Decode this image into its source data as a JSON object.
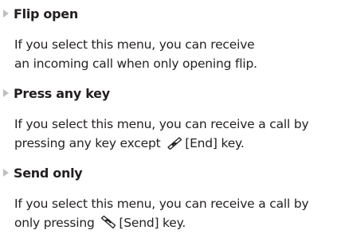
{
  "sections": [
    {
      "heading": "Flip open",
      "text": "If you select this menu, you can receive an incoming call when only opening flip."
    },
    {
      "heading": "Press any key",
      "text_before_icon": "If you select this menu, you can receive a call by pressing any key except",
      "icon": "end-key-icon",
      "text_after_icon": "[End] key."
    },
    {
      "heading": "Send only",
      "text_before_icon": "If you select this menu, you can receive a call by only pressing",
      "icon": "send-key-icon",
      "text_after_icon": "[Send] key."
    }
  ],
  "colors": {
    "text": "#231f20",
    "bullet": "#bfbfbf"
  }
}
